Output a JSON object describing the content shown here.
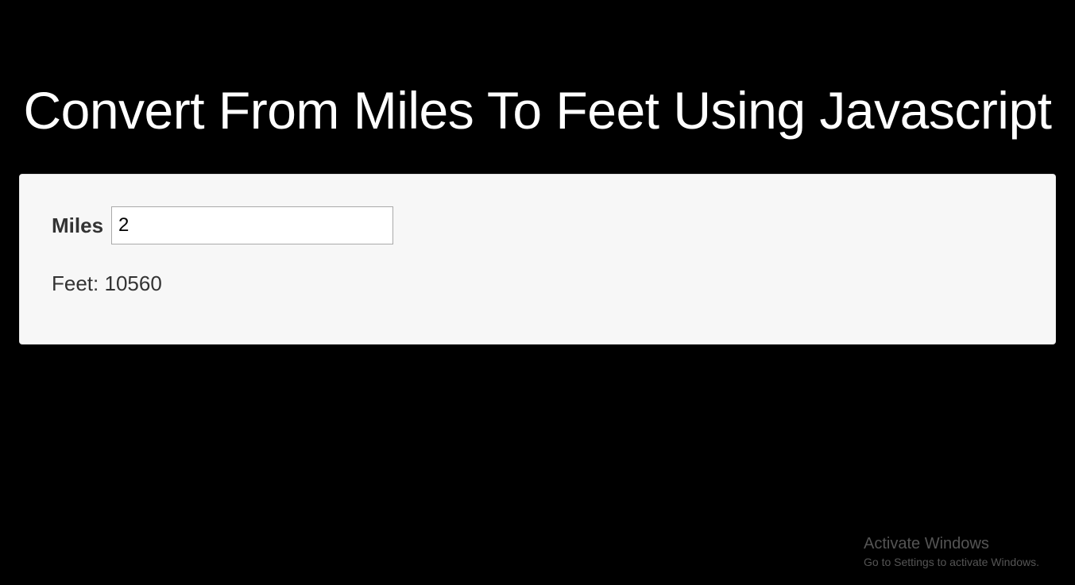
{
  "page": {
    "title": "Convert From Miles To Feet Using Javascript"
  },
  "form": {
    "miles_label": "Miles",
    "miles_value": "2",
    "result_label": "Feet:",
    "result_value": "10560"
  },
  "watermark": {
    "title": "Activate Windows",
    "subtitle": "Go to Settings to activate Windows."
  }
}
